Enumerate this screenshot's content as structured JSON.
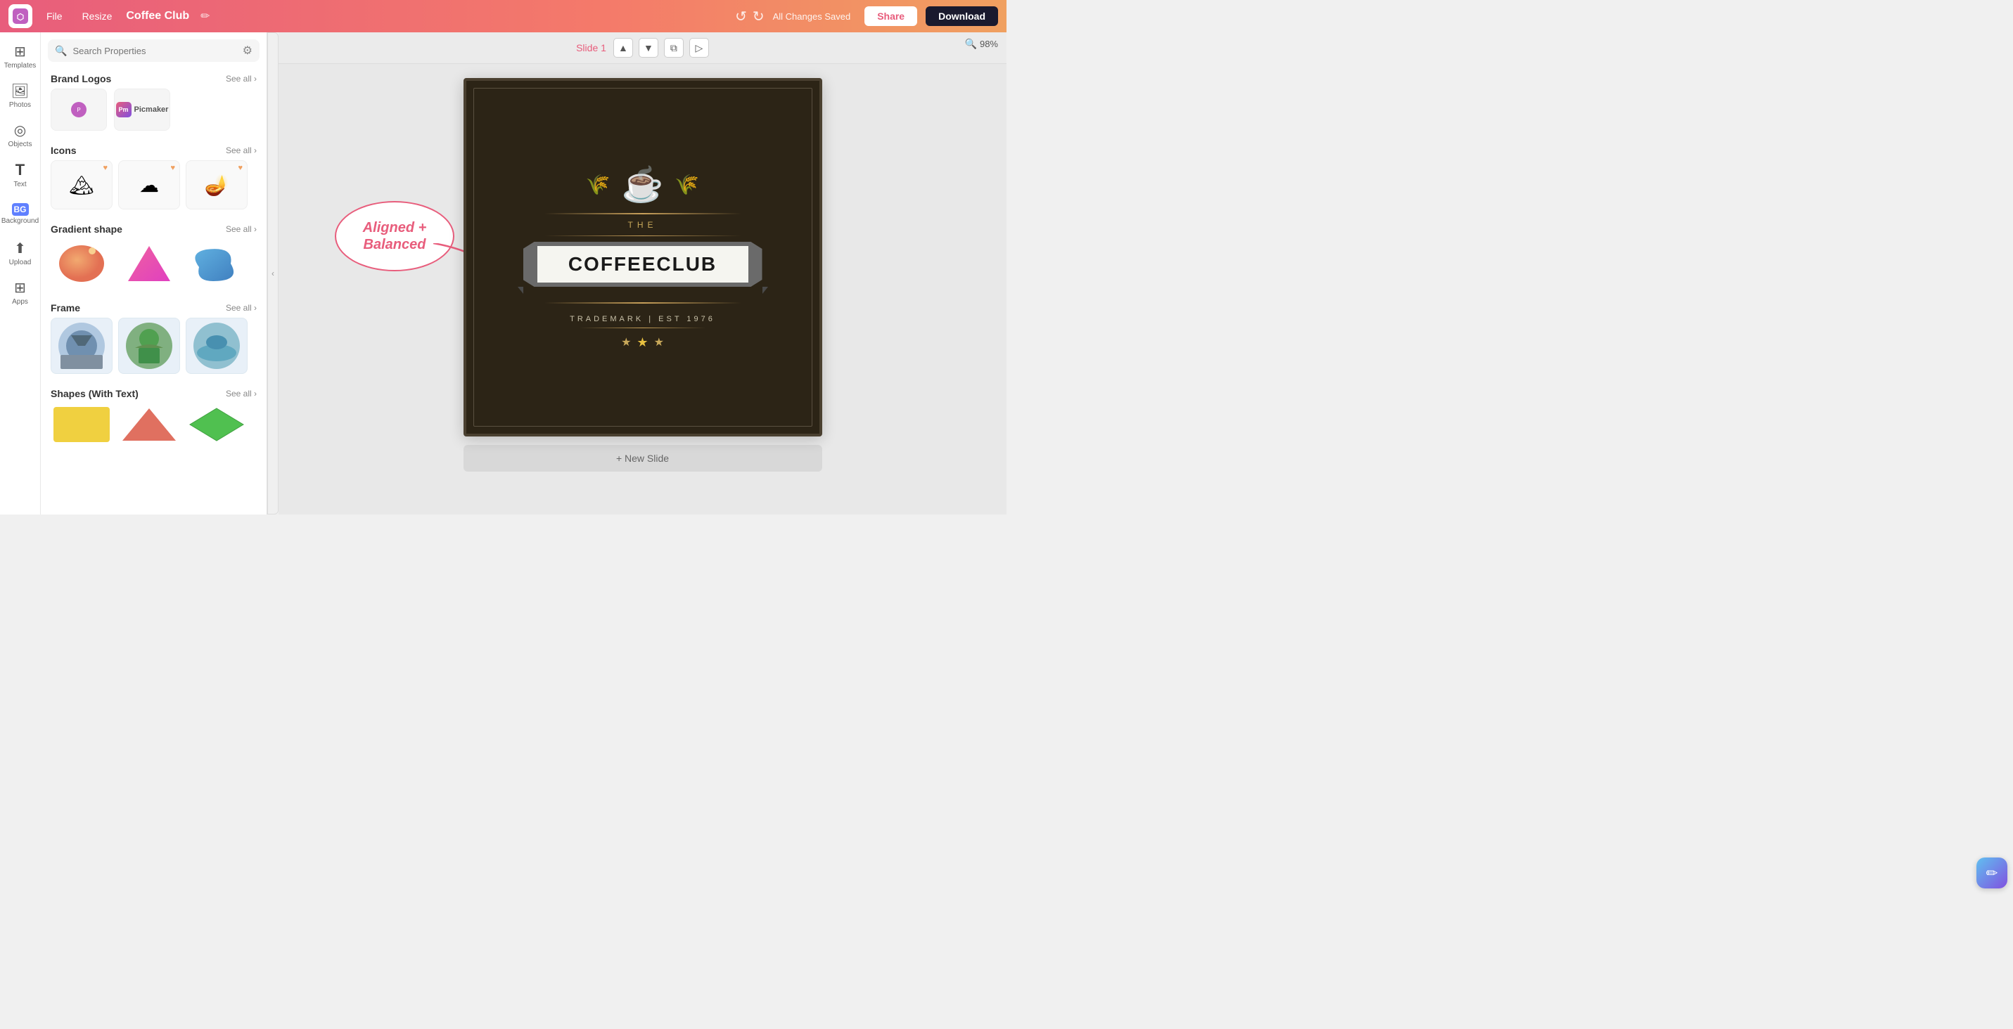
{
  "header": {
    "logo_symbol": "⬡",
    "file_label": "File",
    "resize_label": "Resize",
    "project_title": "Coffee Club",
    "undo_symbol": "↺",
    "redo_symbol": "↻",
    "saved_status": "All Changes Saved",
    "share_label": "Share",
    "download_label": "Download"
  },
  "icon_bar": {
    "items": [
      {
        "id": "templates",
        "symbol": "⊞",
        "label": "Templates"
      },
      {
        "id": "photos",
        "symbol": "🖼",
        "label": "Photos"
      },
      {
        "id": "objects",
        "symbol": "◎",
        "label": "Objects"
      },
      {
        "id": "text",
        "symbol": "T",
        "label": "Text"
      },
      {
        "id": "background",
        "symbol": "BG",
        "label": "Background"
      },
      {
        "id": "upload",
        "symbol": "↑",
        "label": "Upload"
      },
      {
        "id": "apps",
        "symbol": "⊞",
        "label": "Apps"
      }
    ]
  },
  "sidebar": {
    "search_placeholder": "Search Properties",
    "sections": [
      {
        "id": "brand-logos",
        "title": "Brand Logos",
        "see_all": "See all ›"
      },
      {
        "id": "icons",
        "title": "Icons",
        "see_all": "See all ›"
      },
      {
        "id": "gradient-shape",
        "title": "Gradient shape",
        "see_all": "See all ›"
      },
      {
        "id": "frame",
        "title": "Frame",
        "see_all": "See all ›"
      },
      {
        "id": "shapes-with-text",
        "title": "Shapes (With Text)",
        "see_all": "See all ›"
      }
    ]
  },
  "canvas": {
    "slide_label": "Slide 1",
    "zoom_level": "98%",
    "new_slide_label": "+ New Slide",
    "design": {
      "the_text": "THE",
      "coffeeclub_text": "COFFEECLUB",
      "trademark_text": "TRADEMARK | EST 1976"
    }
  },
  "speech_bubble": {
    "text": "Aligned +\nBalanced",
    "arrow_direction": "right"
  },
  "floating_button": {
    "symbol": "✏"
  }
}
